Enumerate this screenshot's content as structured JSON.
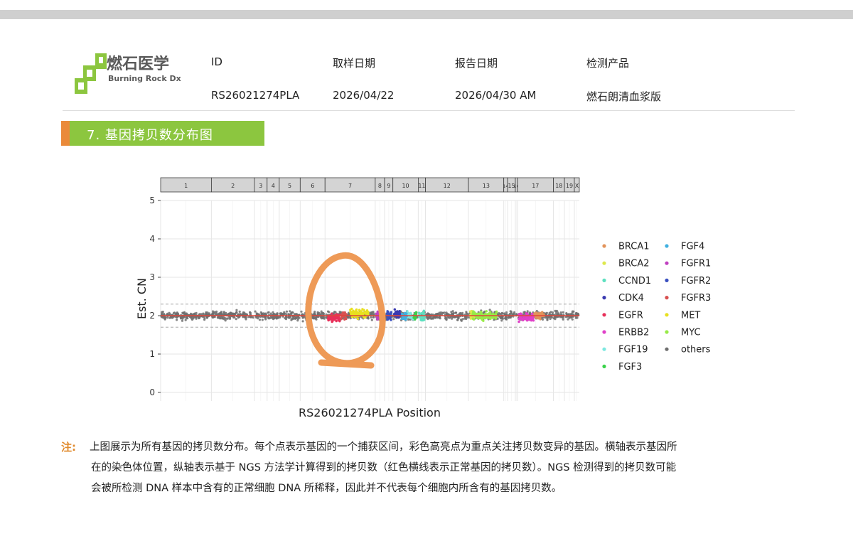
{
  "header": {
    "logo_cn": "燃石医学",
    "logo_en": "Burning Rock Dx",
    "fields": [
      {
        "label": "ID",
        "value": "RS26021274PLA"
      },
      {
        "label": "取样日期",
        "value": "2026/04/22"
      },
      {
        "label": "报告日期",
        "value": "2026/04/30 AM"
      },
      {
        "label": "检测产品",
        "value": "燃石朗清血浆版"
      }
    ]
  },
  "section": {
    "title": "7. 基因拷贝数分布图"
  },
  "colors": {
    "brand_green": "#8cc63f",
    "brand_orange": "#ea8a3a",
    "normal_line": "#e0463a",
    "others": "#6e6e6e"
  },
  "chart_data": {
    "type": "scatter",
    "xlabel": "RS26021274PLA Position",
    "ylabel": "Est. CN",
    "ylim": [
      0,
      5
    ],
    "yticks": [
      0,
      1,
      2,
      3,
      4,
      5
    ],
    "normal_cn": 2,
    "grid": true,
    "legend_position": "right",
    "chromosomes": [
      {
        "label": "1",
        "size": 9.2
      },
      {
        "label": "2",
        "size": 7.8
      },
      {
        "label": "3",
        "size": 2.3
      },
      {
        "label": "4",
        "size": 2.2
      },
      {
        "label": "5",
        "size": 3.8
      },
      {
        "label": "6",
        "size": 4.5
      },
      {
        "label": "7",
        "size": 9.1
      },
      {
        "label": "8",
        "size": 1.7
      },
      {
        "label": "9",
        "size": 1.5
      },
      {
        "label": "10",
        "size": 4.6
      },
      {
        "label": "11",
        "size": 1.3
      },
      {
        "label": "12",
        "size": 7.8
      },
      {
        "label": "13",
        "size": 6.4
      },
      {
        "label": "14",
        "size": 0.7
      },
      {
        "label": "15",
        "size": 1.4
      },
      {
        "label": "16",
        "size": 0.4
      },
      {
        "label": "17",
        "size": 6.5
      },
      {
        "label": "18",
        "size": 2.0
      },
      {
        "label": "19",
        "size": 1.8
      },
      {
        "label": "X",
        "size": 0.9
      }
    ],
    "genes": [
      {
        "name": "BRCA1",
        "color": "#e2935a",
        "chrom": "17",
        "from": 0.45,
        "to": 0.75,
        "cn": 2.0
      },
      {
        "name": "BRCA2",
        "color": "#dde84d",
        "chrom": "13",
        "from": 0.05,
        "to": 0.2,
        "cn": 2.0
      },
      {
        "name": "CCND1",
        "color": "#5ee0c0",
        "chrom": "11",
        "from": 0.1,
        "to": 0.9,
        "cn": 2.0
      },
      {
        "name": "CDK4",
        "color": "#3a3ab0",
        "chrom": "10",
        "from": 0.05,
        "to": 0.32,
        "cn": 2.05
      },
      {
        "name": "EGFR",
        "color": "#e8305a",
        "chrom": "7",
        "from": 0.05,
        "to": 0.32,
        "cn": 1.95
      },
      {
        "name": "ERBB2",
        "color": "#e040c8",
        "chrom": "17",
        "from": 0.03,
        "to": 0.45,
        "cn": 1.95
      },
      {
        "name": "FGF19",
        "color": "#7de8e0",
        "chrom": "10",
        "from": 0.55,
        "to": 0.8,
        "cn": 2.0
      },
      {
        "name": "FGF3",
        "color": "#3ad24a",
        "chrom": "10",
        "from": 0.82,
        "to": 0.92,
        "cn": 2.0
      },
      {
        "name": "FGF4",
        "color": "#40b0e0",
        "chrom": "10",
        "from": 0.35,
        "to": 0.55,
        "cn": 2.0
      },
      {
        "name": "FGFR1",
        "color": "#c040c0",
        "chrom": "8",
        "from": 0.1,
        "to": 0.9,
        "cn": 2.0
      },
      {
        "name": "FGFR2",
        "color": "#3a50c0",
        "chrom": "9",
        "from": 0.2,
        "to": 0.8,
        "cn": 2.0
      },
      {
        "name": "FGFR3",
        "color": "#d85050",
        "chrom": "7",
        "from": 0.32,
        "to": 0.42,
        "cn": 2.0
      },
      {
        "name": "MET",
        "color": "#e8e020",
        "chrom": "7",
        "from": 0.5,
        "to": 0.86,
        "cn": 2.05
      },
      {
        "name": "MYC",
        "color": "#98ea48",
        "chrom": "13",
        "from": 0.1,
        "to": 0.8,
        "cn": 2.0
      },
      {
        "name": "others",
        "color": "#6e6e6e",
        "chrom": "all",
        "cn": 2.0
      }
    ]
  },
  "note": {
    "label": "注:",
    "lines": [
      "上图展示为所有基因的拷贝数分布。每个点表示基因的一个捕获区间，彩色高亮点为重点关注拷贝数变异的基因。横轴表示基因所",
      "在的染色体位置，纵轴表示基于 NGS 方法学计算得到的拷贝数（红色横线表示正常基因的拷贝数）。NGS 检测得到的拷贝数可能",
      "会被所检测 DNA 样本中含有的正常细胞 DNA 所稀释，因此并不代表每个细胞内所含有的基因拷贝数。"
    ]
  }
}
